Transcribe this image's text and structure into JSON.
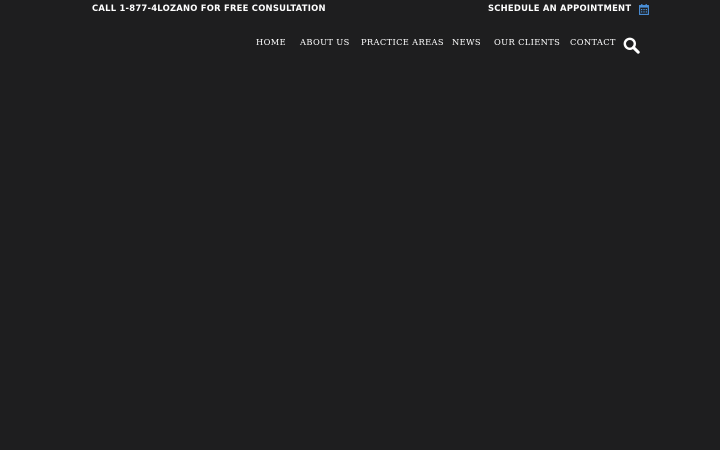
{
  "topbar": {
    "call_text": "CALL 1-877-4LOZANO FOR FREE CONSULTATION",
    "schedule_text": "SCHEDULE AN APPOINTMENT",
    "schedule_icon": "calendar-icon"
  },
  "nav": {
    "items": [
      {
        "label": "HOME"
      },
      {
        "label": "ABOUT US"
      },
      {
        "label": "PRACTICE AREAS"
      },
      {
        "label": "NEWS"
      },
      {
        "label": "OUR CLIENTS"
      },
      {
        "label": "CONTACT"
      }
    ],
    "search_icon": "search-icon"
  },
  "colors": {
    "background": "#1e1e1f",
    "text": "#ffffff",
    "accent": "#4a90d9"
  }
}
